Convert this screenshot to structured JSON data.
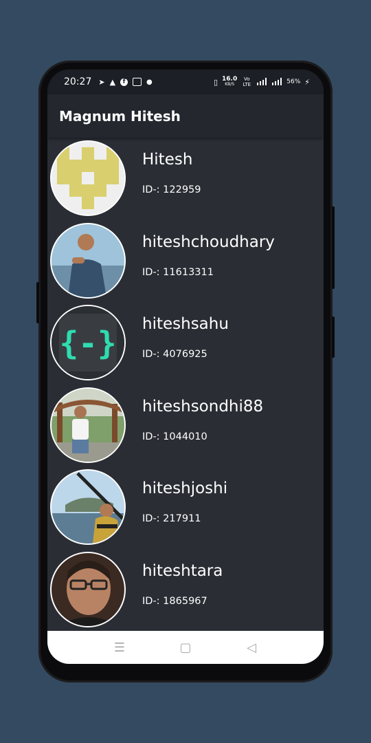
{
  "status_bar": {
    "time": "20:27",
    "left_icons": [
      "telegram-icon",
      "graduation-cap-icon",
      "facebook-icon",
      "image-icon",
      "dot-icon"
    ],
    "network_speed": "16.0",
    "network_speed_unit": "KB/S",
    "volte": "Vo LTE",
    "battery": "56%"
  },
  "app_bar": {
    "title": "Magnum Hitesh"
  },
  "users": [
    {
      "name": "Hitesh",
      "id_label": "ID-: 122959"
    },
    {
      "name": "hiteshchoudhary",
      "id_label": "ID-: 11613311"
    },
    {
      "name": "hiteshsahu",
      "id_label": "ID-: 4076925"
    },
    {
      "name": "hiteshsondhi88",
      "id_label": "ID-: 1044010"
    },
    {
      "name": "hiteshjoshi",
      "id_label": "ID-: 217911"
    },
    {
      "name": "hiteshtara",
      "id_label": "ID-: 1865967"
    }
  ],
  "nav_bar": {
    "recents_icon": "☰",
    "home_icon": "▢",
    "back_icon": "◁"
  }
}
